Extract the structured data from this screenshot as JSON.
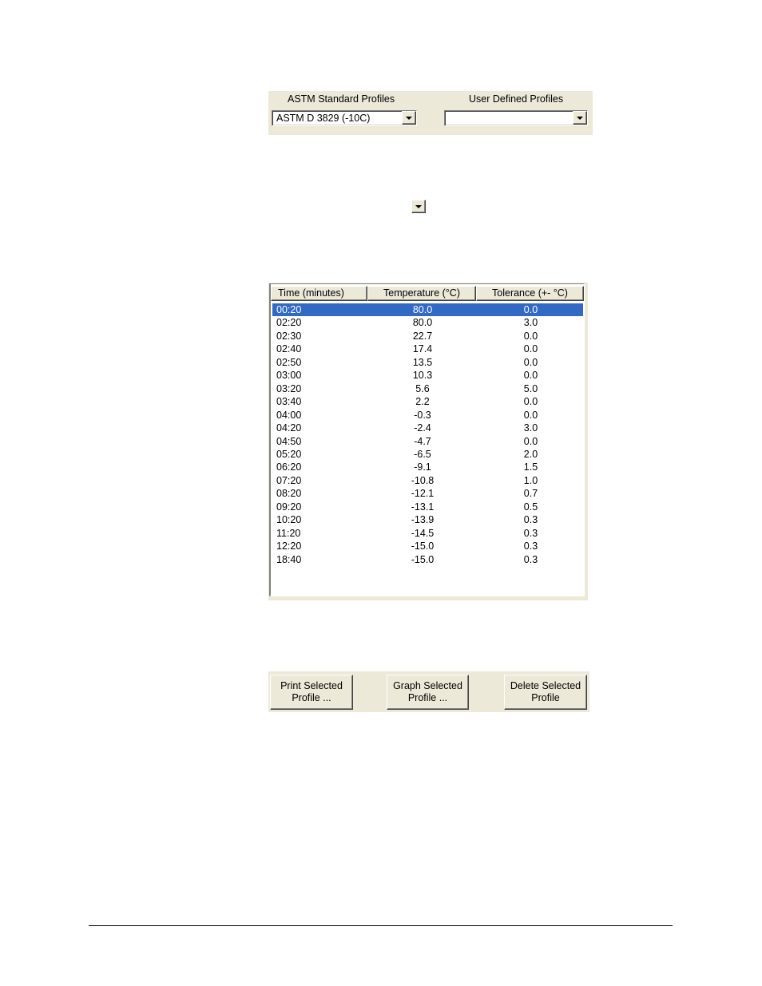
{
  "profiles": {
    "astm_label": "ASTM Standard Profiles",
    "astm_selected": "ASTM D 3829 (-10C)",
    "user_label": "User Defined Profiles",
    "user_selected": ""
  },
  "dropdown_icon": "chevron-down-icon",
  "table": {
    "columns": [
      "Time (minutes)",
      "Temperature (°C)",
      "Tolerance (+- °C)"
    ],
    "rows": [
      [
        "00:20",
        "80.0",
        "0.0"
      ],
      [
        "02:20",
        "80.0",
        "3.0"
      ],
      [
        "02:30",
        "22.7",
        "0.0"
      ],
      [
        "02:40",
        "17.4",
        "0.0"
      ],
      [
        "02:50",
        "13.5",
        "0.0"
      ],
      [
        "03:00",
        "10.3",
        "0.0"
      ],
      [
        "03:20",
        "5.6",
        "5.0"
      ],
      [
        "03:40",
        "2.2",
        "0.0"
      ],
      [
        "04:00",
        "-0.3",
        "0.0"
      ],
      [
        "04:20",
        "-2.4",
        "3.0"
      ],
      [
        "04:50",
        "-4.7",
        "0.0"
      ],
      [
        "05:20",
        "-6.5",
        "2.0"
      ],
      [
        "06:20",
        "-9.1",
        "1.5"
      ],
      [
        "07:20",
        "-10.8",
        "1.0"
      ],
      [
        "08:20",
        "-12.1",
        "0.7"
      ],
      [
        "09:20",
        "-13.1",
        "0.5"
      ],
      [
        "10:20",
        "-13.9",
        "0.3"
      ],
      [
        "11:20",
        "-14.5",
        "0.3"
      ],
      [
        "12:20",
        "-15.0",
        "0.3"
      ],
      [
        "18:40",
        "-15.0",
        "0.3"
      ]
    ],
    "selected_row": 0
  },
  "buttons": {
    "print": [
      "Print Selected",
      "Profile ..."
    ],
    "graph": [
      "Graph Selected",
      "Profile ..."
    ],
    "delete": [
      "Delete Selected",
      "Profile"
    ]
  },
  "colors": {
    "panel": "#ece9d8",
    "selection": "#316ac5"
  }
}
